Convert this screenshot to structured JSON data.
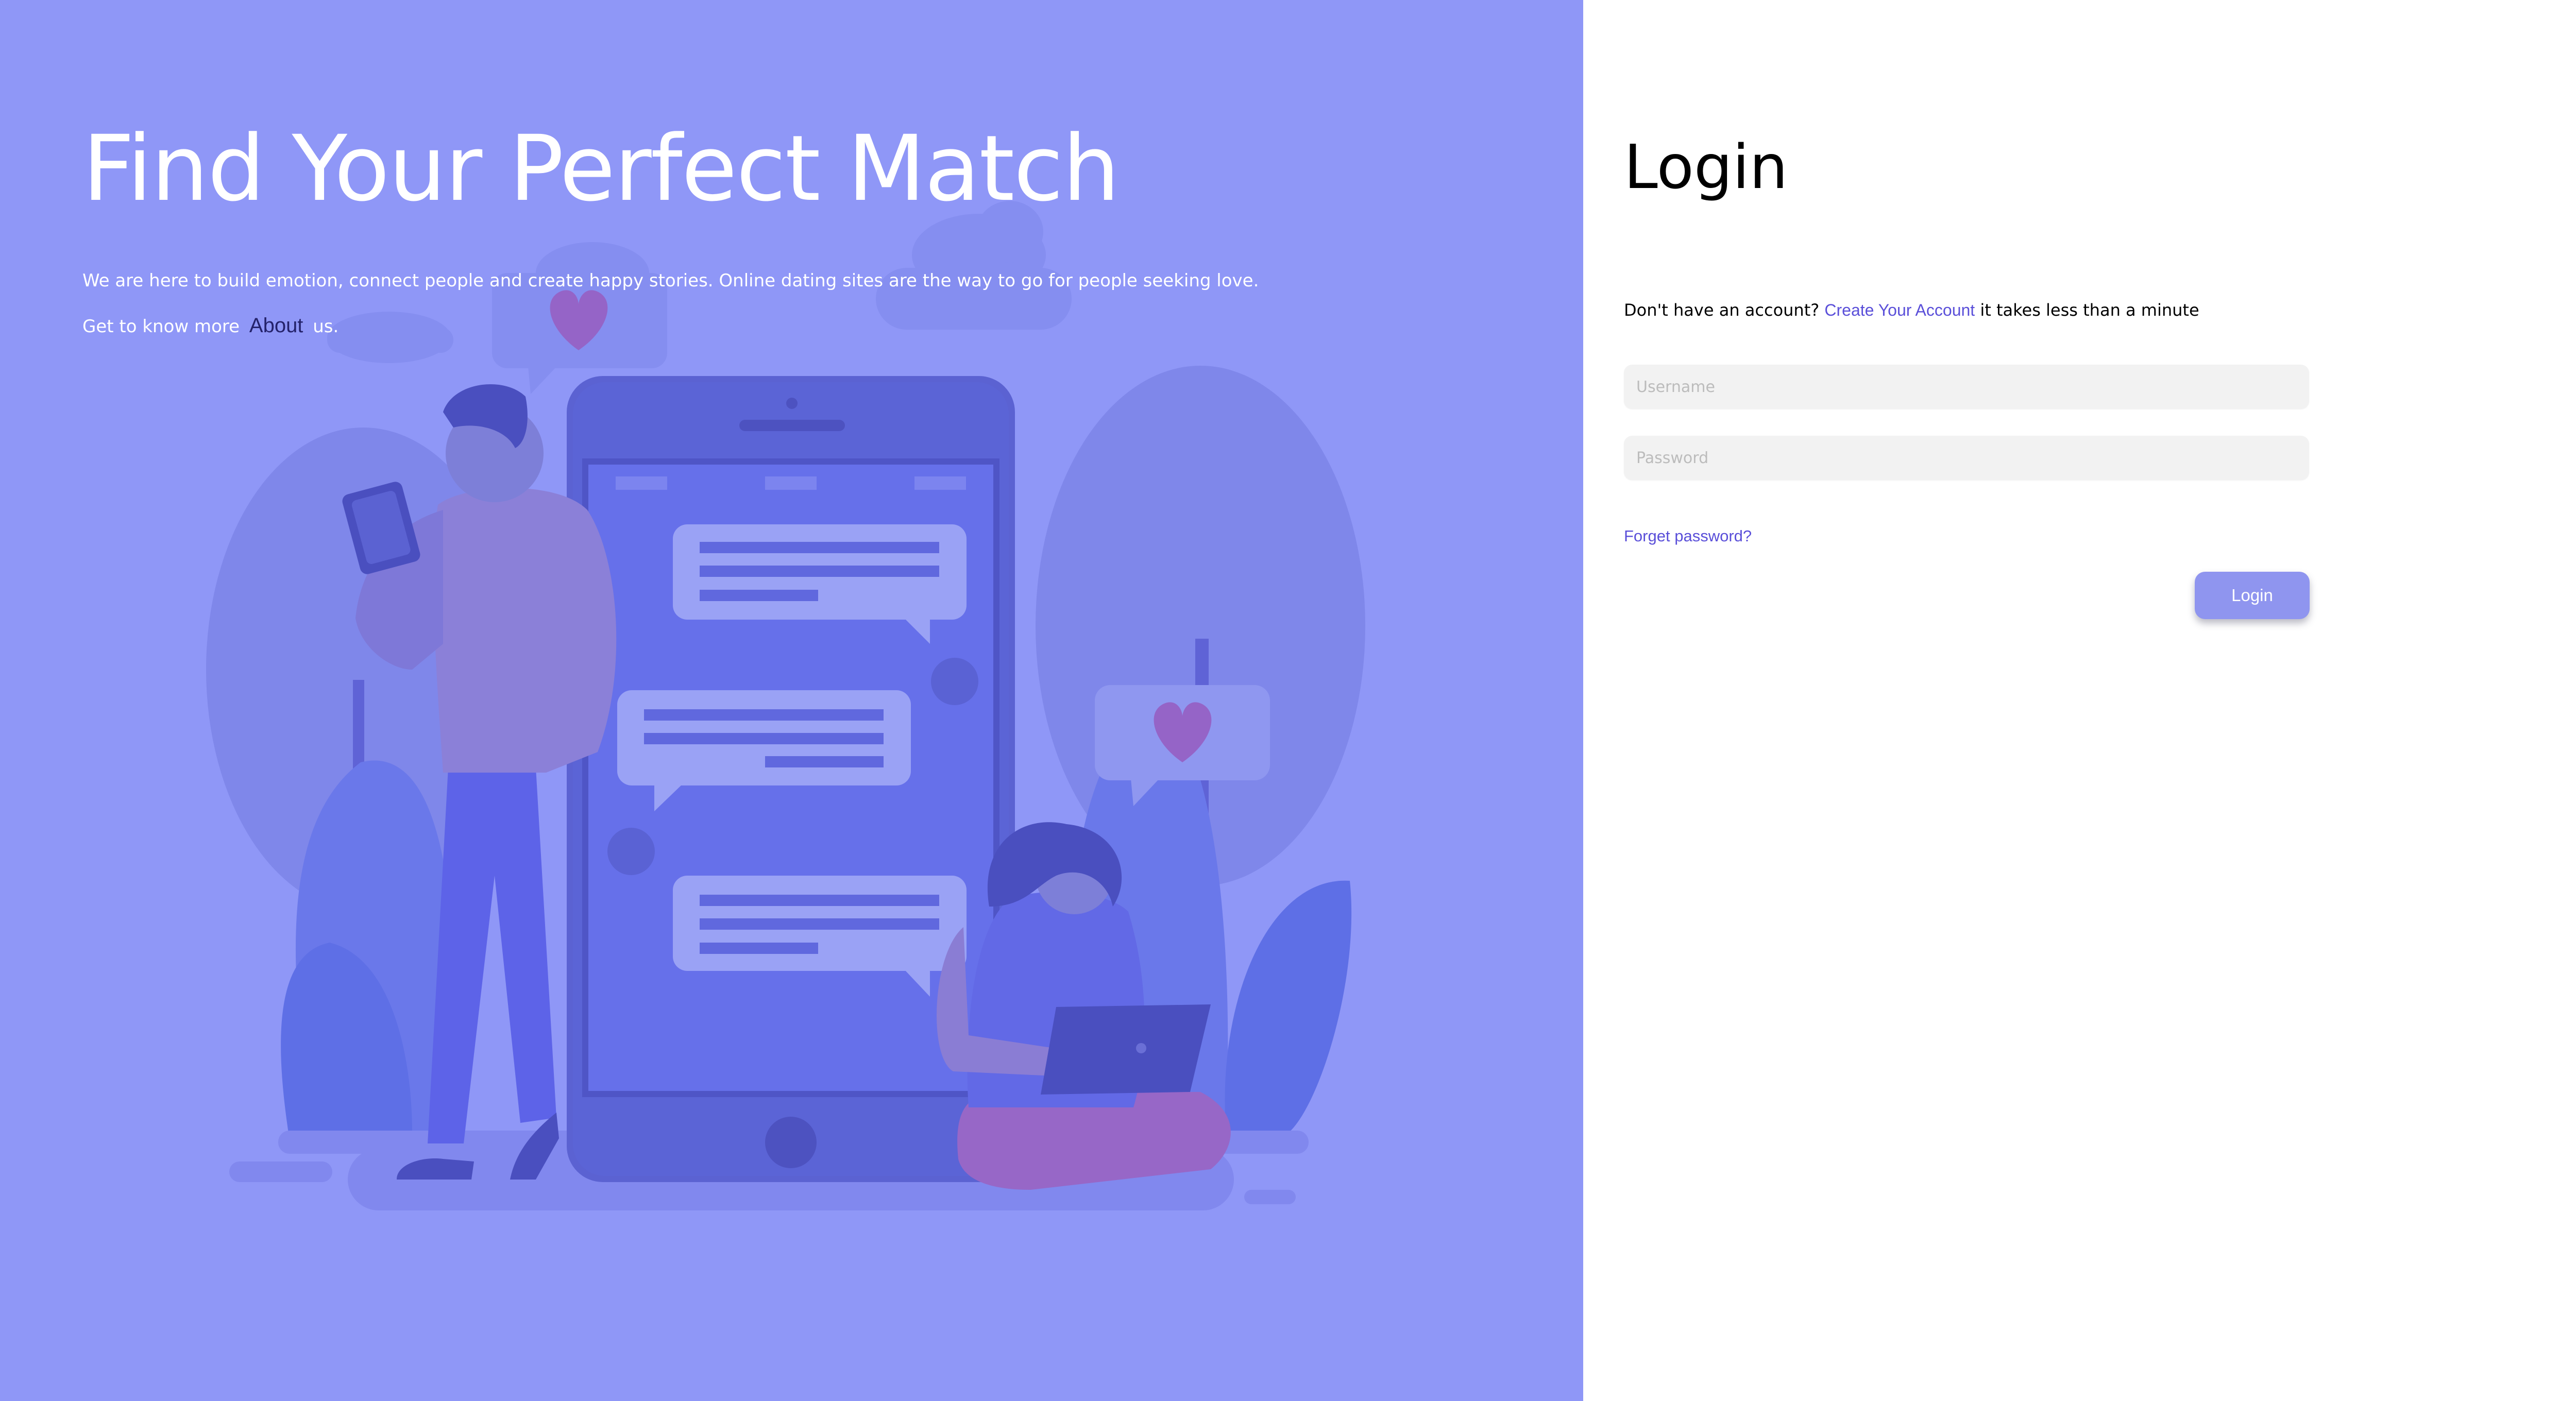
{
  "hero": {
    "title": "Find Your Perfect Match",
    "description": "We are here to build emotion, connect people and create happy stories. Online dating sites are the way to go for people seeking love.",
    "more_prefix": "Get to know more",
    "about_link": "About",
    "more_suffix": "us."
  },
  "login": {
    "title": "Login",
    "signup_prefix": "Don't have an account?",
    "signup_link": "Create Your Account",
    "signup_suffix": "it takes less than a minute",
    "username_placeholder": "Username",
    "password_placeholder": "Password",
    "forgot_link": "Forget password?",
    "button_label": "Login"
  },
  "colors": {
    "hero_background": "#8f97f7",
    "accent": "#5a4fd9",
    "button": "#8f95ef",
    "input_background": "#f2f2f2"
  },
  "icons": [
    "heart-icon",
    "chat-bubble-icon",
    "smartphone-icon",
    "laptop-icon"
  ]
}
